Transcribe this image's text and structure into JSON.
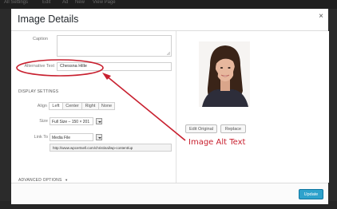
{
  "top_bar": {
    "items": [
      "All Settings",
      "Edit",
      "Ad",
      "New",
      "View Page"
    ]
  },
  "modal": {
    "title": "Image Details",
    "close_glyph": "×"
  },
  "form": {
    "caption_label": "Caption",
    "caption_value": "",
    "alt_label": "Alternative Text",
    "alt_value": "Chessna Hille",
    "display_settings_label": "DISPLAY SETTINGS",
    "align_label": "Align",
    "align_options": [
      "Left",
      "Center",
      "Right",
      "None"
    ],
    "align_selected": "Left",
    "size_label": "Size",
    "size_value": "Full Size – 150 × 201",
    "link_label": "Link To",
    "link_value": "Media File",
    "link_url": "http://www.wpcertsell.com/christinal/wp-content/up",
    "advanced_label": "ADVANCED OPTIONS",
    "advanced_glyph": "▼"
  },
  "image_panel": {
    "edit_original": "Edit Original",
    "replace": "Replace"
  },
  "footer": {
    "update_label": "Update"
  },
  "annotation": {
    "text": "Image Alt Text",
    "color": "#c8202f"
  },
  "colors": {
    "accent": "#2ea2cc",
    "annotation": "#c8202f"
  },
  "icons": [
    "close-icon",
    "dropdown-arrow-icon",
    "expand-arrow-icon",
    "arrow-annotation-icon"
  ]
}
